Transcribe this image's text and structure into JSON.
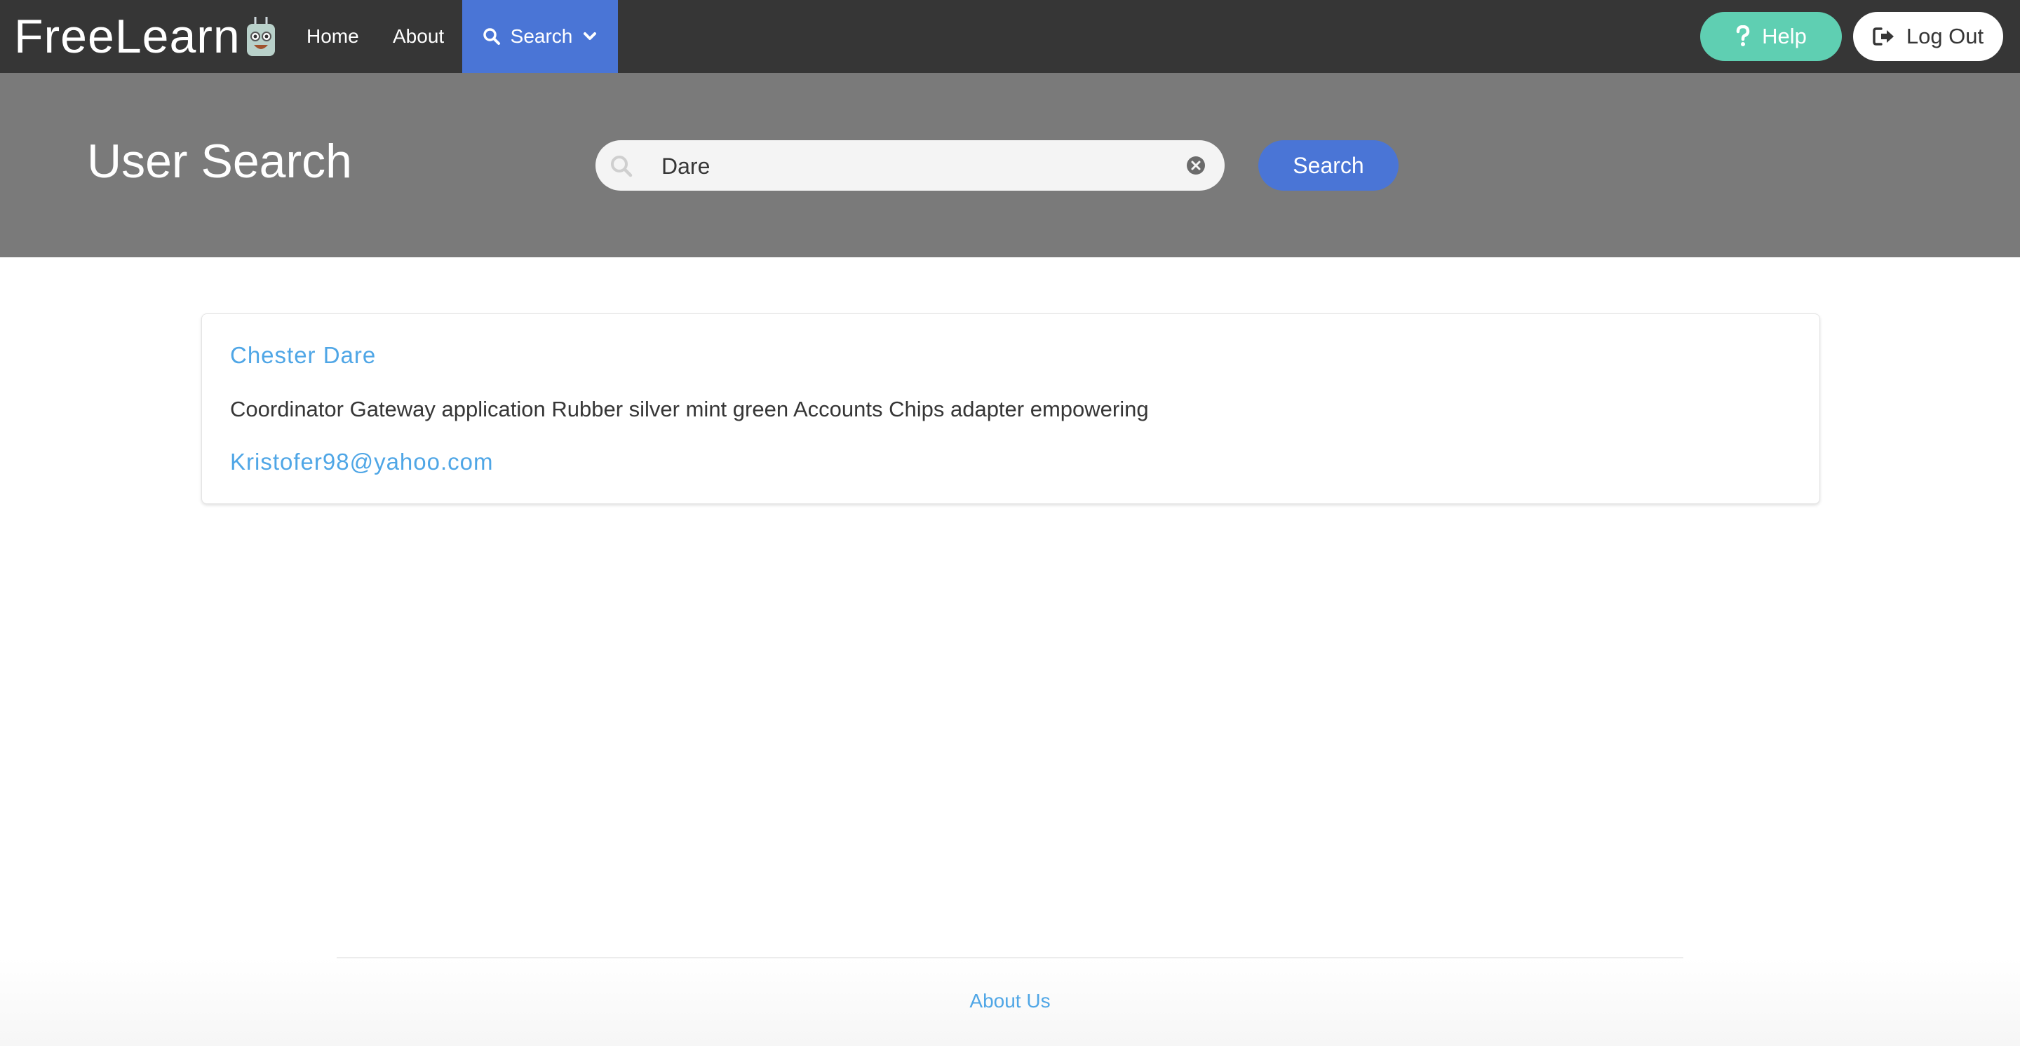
{
  "navbar": {
    "brand": "FreeLearn",
    "links": {
      "home": "Home",
      "about": "About"
    },
    "search_menu": {
      "label": "Search",
      "icon": "search-icon",
      "caret_icon": "chevron-down-icon"
    },
    "help_button": {
      "label": "Help",
      "icon": "question-icon"
    },
    "logout_button": {
      "label": "Log Out",
      "icon": "sign-out-icon"
    }
  },
  "hero": {
    "title": "User Search",
    "search_field": {
      "value": "Dare",
      "icon": "search-icon",
      "clear_icon": "clear-icon"
    },
    "search_button": "Search"
  },
  "results": [
    {
      "name": "Chester Dare",
      "description": "Coordinator Gateway application Rubber silver mint green Accounts Chips adapter empowering",
      "email": "Kristofer98@yahoo.com"
    }
  ],
  "footer": {
    "link": "About Us"
  },
  "colors": {
    "navbar_bg": "#363636",
    "accent_blue": "#4a75d6",
    "help_teal": "#5fcfb2",
    "hero_bg": "#7a7a7a",
    "link_blue": "#4fa6e6"
  }
}
